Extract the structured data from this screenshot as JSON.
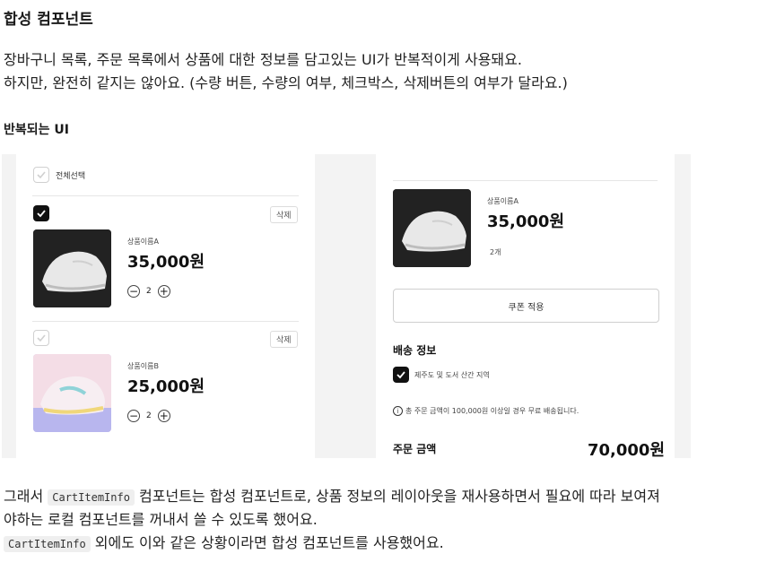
{
  "heading": "합성 컴포넌트",
  "para1_line1": "장바구니 목록, 주문 목록에서 상품에 대한 정보를 담고있는 UI가 반복적이게 사용돼요.",
  "para1_line2": "하지만, 완전히 같지는 않아요. (수량 버튼, 수량의 여부, 체크박스, 삭제버튼의 여부가 달라요.)",
  "subheading": "반복되는 UI",
  "cart": {
    "select_all": "전체선택",
    "delete_label": "삭제",
    "items": [
      {
        "name": "상품이름A",
        "price": "35,000원",
        "qty": "2",
        "checked": true
      },
      {
        "name": "상품이름B",
        "price": "25,000원",
        "qty": "2",
        "checked": false
      }
    ]
  },
  "order": {
    "item": {
      "name": "상품이름A",
      "price": "35,000원",
      "qty_text": "2개"
    },
    "coupon_button": "쿠폰 적용",
    "shipping_title": "배송 정보",
    "shipping_option": "제주도 및 도서 산간 지역",
    "notice": "총 주문 금액이 100,000원 이상일 경우 무료 배송됩니다.",
    "total_label": "주문 금액",
    "total_value": "70,000원"
  },
  "footer": {
    "line1_pre": "그래서 ",
    "code1": "CartItemInfo",
    "line1_post": " 컴포넌트는 합성 컴포넌트로, 상품 정보의 레이아웃을 재사용하면서 필요에 따라 보여져",
    "line2": "야하는 로컬 컴포넌트를 꺼내서 쓸 수 있도록 했어요.",
    "code2": "CartItemInfo",
    "line3_post": " 외에도 이와 같은 상황이라면 합성 컴포넌트를 사용했어요."
  },
  "colors": {
    "checkbox_on": "#111111",
    "panel_bg": "#f3f3f3"
  }
}
